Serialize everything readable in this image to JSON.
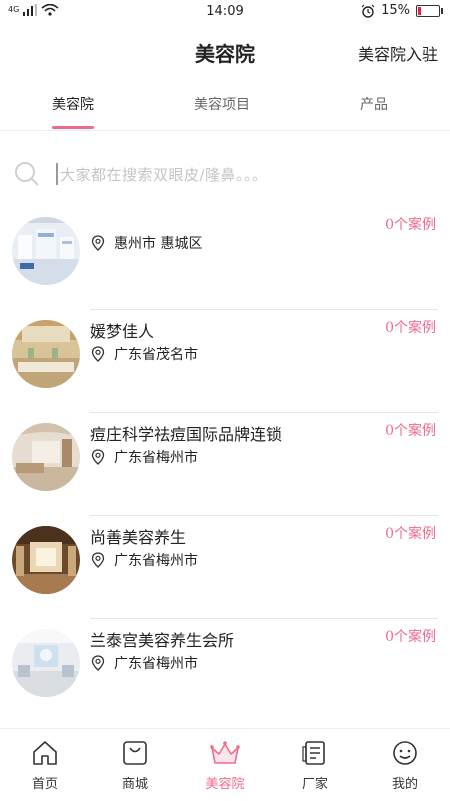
{
  "status_bar": {
    "network_label": "4G",
    "time": "14:09",
    "battery_percent": "15%",
    "battery_level": 0.15,
    "accent_color": "#e0223a"
  },
  "header": {
    "title": "美容院",
    "join_label": "美容院入驻"
  },
  "tabs": [
    {
      "label": "美容院",
      "active": true
    },
    {
      "label": "美容项目",
      "active": false
    },
    {
      "label": "产品",
      "active": false
    }
  ],
  "search": {
    "placeholder": "大家都在搜索双眼皮/隆鼻。。。",
    "icon": "search-icon"
  },
  "salons": [
    {
      "name": "",
      "location": "惠州市 惠城区",
      "cases": "0个案例"
    },
    {
      "name": "媛梦佳人",
      "location": "广东省茂名市",
      "cases": "0个案例"
    },
    {
      "name": "痘庄科学祛痘国际品牌连锁",
      "location": "广东省梅州市",
      "cases": "0个案例"
    },
    {
      "name": "尚善美容养生",
      "location": "广东省梅州市",
      "cases": "0个案例"
    },
    {
      "name": "兰泰宫美容养生会所",
      "location": "广东省梅州市",
      "cases": "0个案例"
    }
  ],
  "bottom_nav": [
    {
      "label": "首页",
      "icon": "home-icon",
      "active": false
    },
    {
      "label": "商城",
      "icon": "shopping-bag-icon",
      "active": false
    },
    {
      "label": "美容院",
      "icon": "crown-icon",
      "active": true
    },
    {
      "label": "厂家",
      "icon": "factory-icon",
      "active": false
    },
    {
      "label": "我的",
      "icon": "profile-smile-icon",
      "active": false
    }
  ],
  "colors": {
    "accent_pink": "#f06a8c",
    "divider": "#e6e6e6"
  }
}
